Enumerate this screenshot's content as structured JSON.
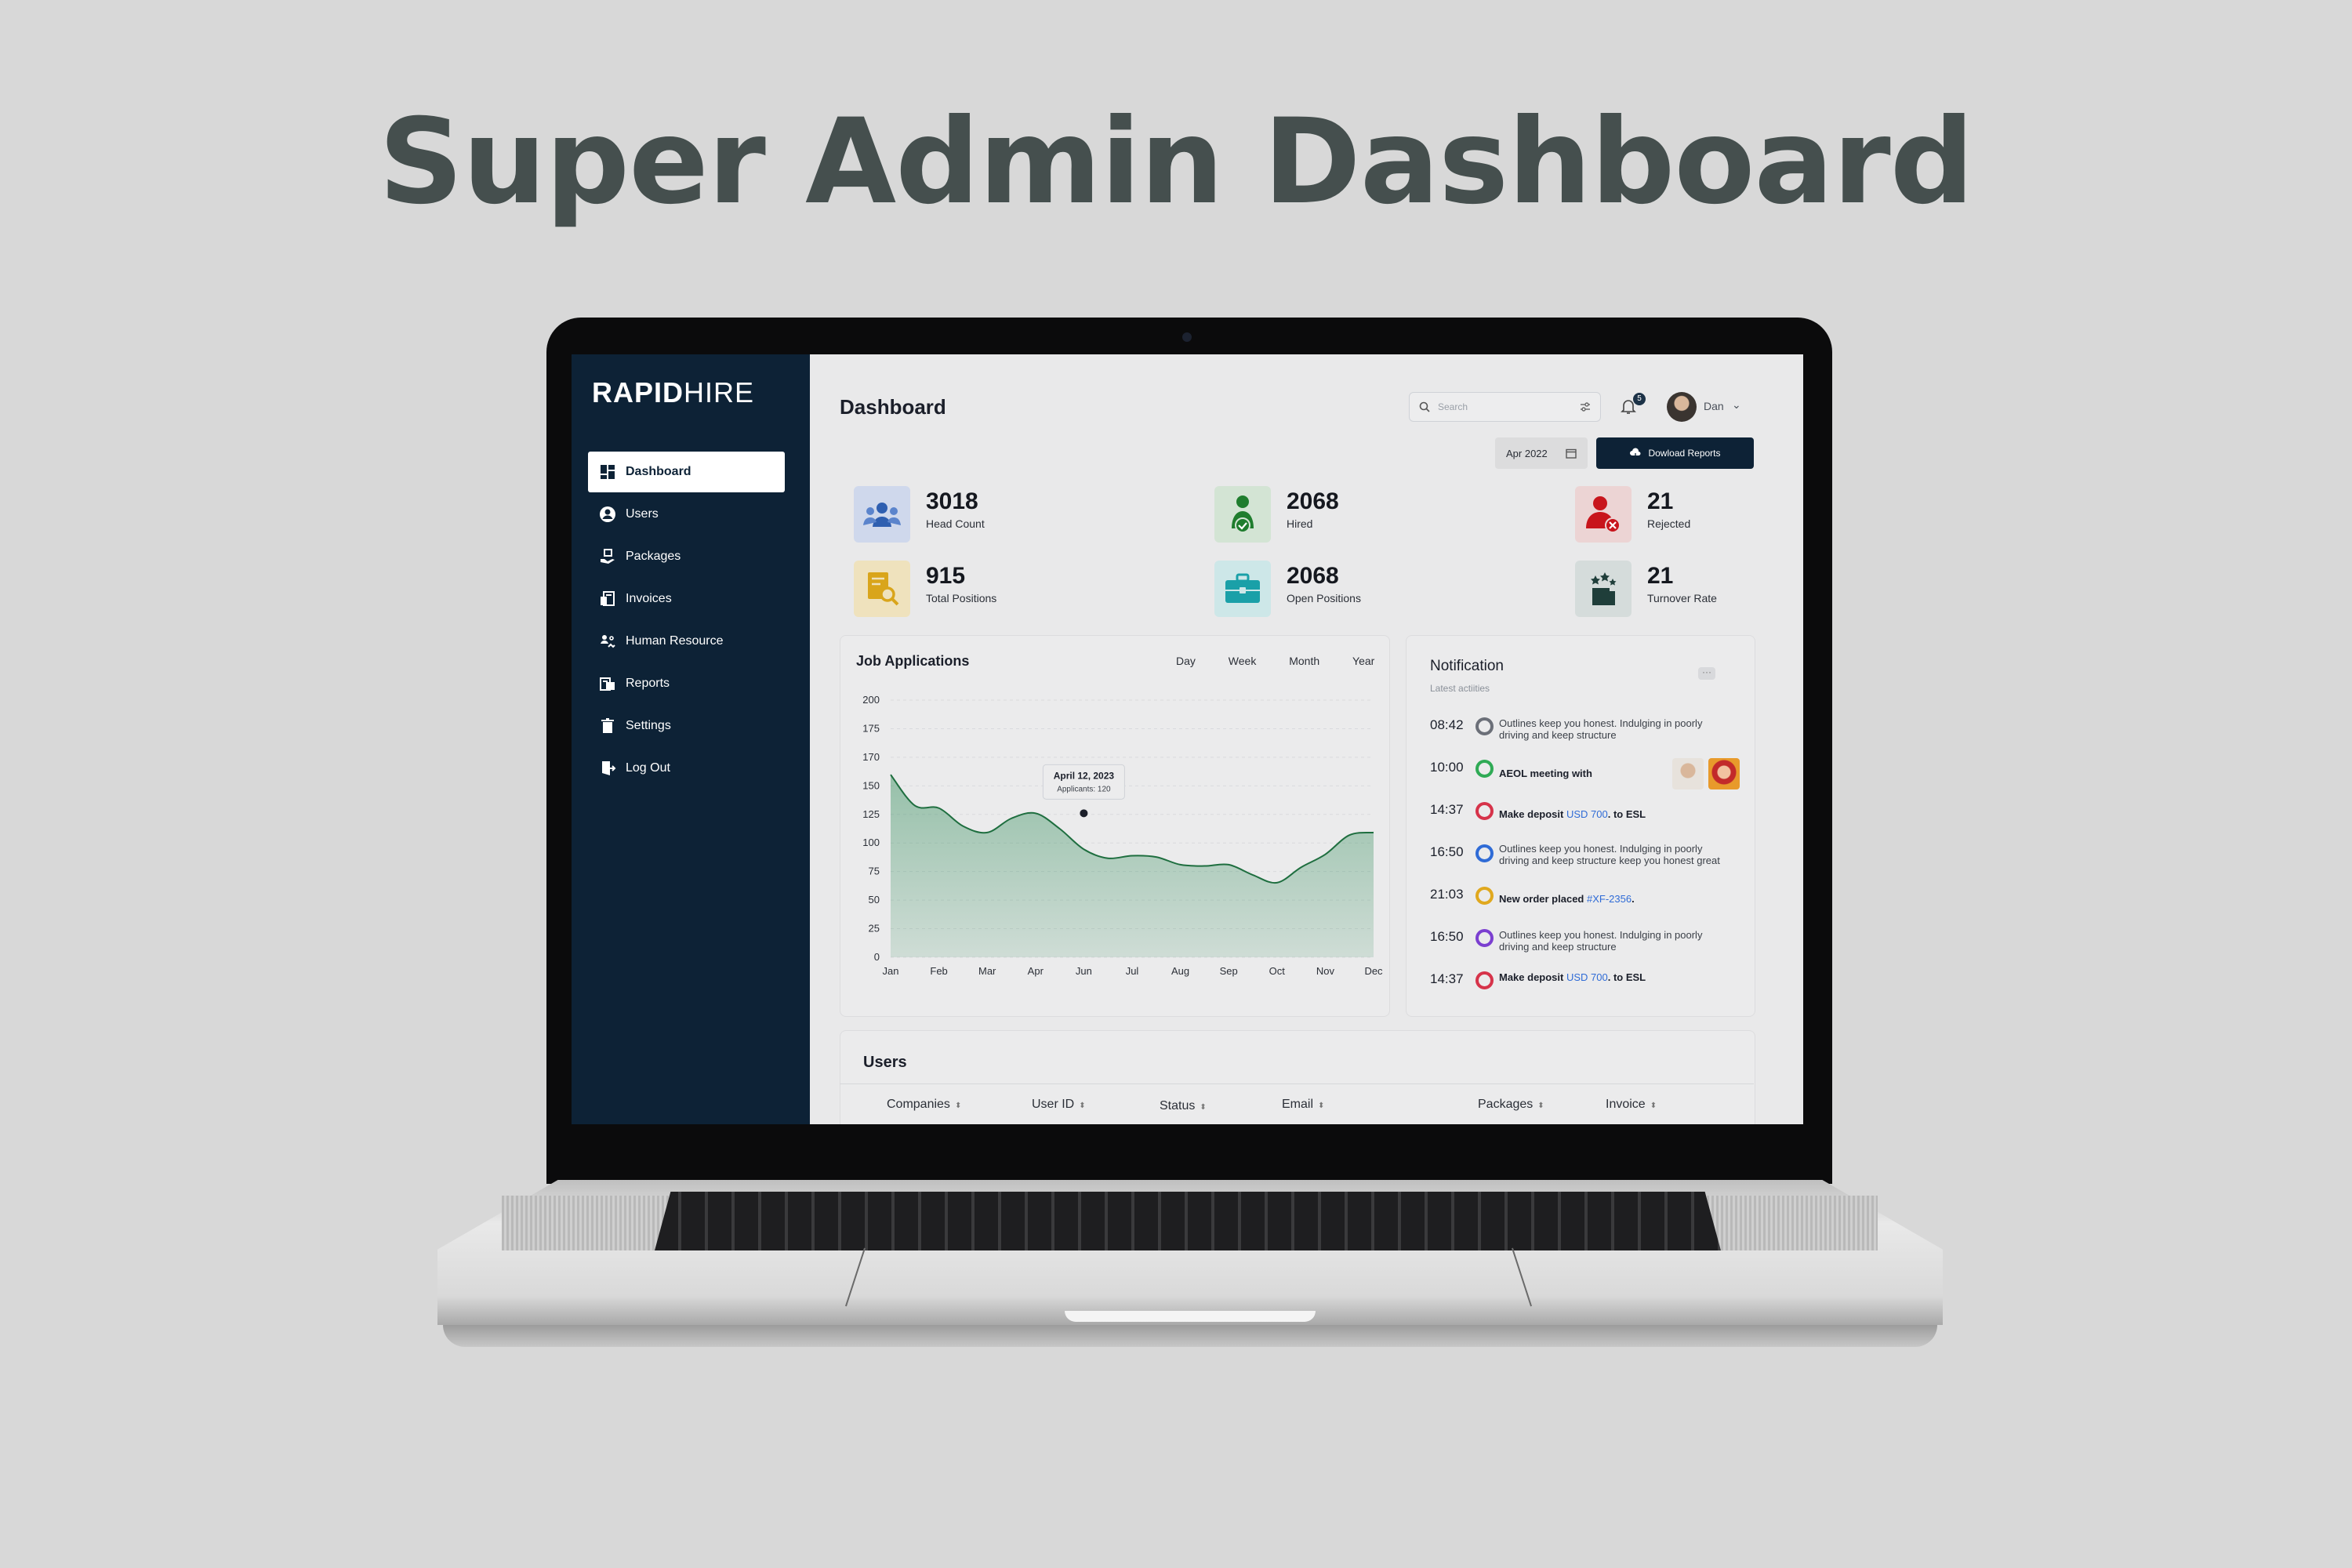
{
  "headline": "Super Admin Dashboard",
  "logo": {
    "bold": "RAPID",
    "light": "HIRE"
  },
  "sidebar": {
    "items": [
      {
        "label": "Dashboard",
        "icon": "dashboard-grid-icon",
        "active": true
      },
      {
        "label": "Users",
        "icon": "user-circle-icon"
      },
      {
        "label": "Packages",
        "icon": "package-hand-icon"
      },
      {
        "label": "Invoices",
        "icon": "invoice-icon"
      },
      {
        "label": "Human Resource",
        "icon": "human-resource-icon"
      },
      {
        "label": "Reports",
        "icon": "reports-icon"
      },
      {
        "label": "Settings",
        "icon": "trash-settings-icon"
      },
      {
        "label": "Log Out",
        "icon": "logout-door-icon"
      }
    ]
  },
  "header": {
    "title": "Dashboard",
    "search_placeholder": "Search",
    "notification_count": "5",
    "user_name": "Dan",
    "date": "Apr 2022",
    "download_label": "Dowload Reports"
  },
  "stats": [
    {
      "value": "3018",
      "label": "Head Count",
      "icon": "team-icon",
      "color": "#2f5fb0"
    },
    {
      "value": "2068",
      "label": "Hired",
      "icon": "user-check-icon",
      "color": "#1f7d2e"
    },
    {
      "value": "21",
      "label": "Rejected",
      "icon": "user-reject-icon",
      "color": "#c8151c"
    },
    {
      "value": "915",
      "label": "Total Positions",
      "icon": "document-search-icon",
      "color": "#d9a51b"
    },
    {
      "value": "2068",
      "label": "Open Positions",
      "icon": "briefcase-icon",
      "color": "#1aa0a8"
    },
    {
      "value": "21",
      "label": "Turnover Rate",
      "icon": "turnover-icon",
      "color": "#1f3e3a"
    }
  ],
  "job_applications": {
    "title": "Job Applications",
    "tabs": [
      "Day",
      "Week",
      "Month",
      "Year"
    ],
    "tooltip": {
      "date": "April 12, 2023",
      "text": "Applicants: 120"
    }
  },
  "chart_data": {
    "type": "area",
    "title": "Job Applications",
    "categories": [
      "Jan",
      "Feb",
      "Mar",
      "Apr",
      "Jun",
      "Jul",
      "Aug",
      "Sep",
      "Oct",
      "Nov",
      "Dec"
    ],
    "y_ticks": [
      "0",
      "25",
      "50",
      "75",
      "100",
      "125",
      "150",
      "170",
      "175",
      "200"
    ],
    "ylim": [
      0,
      200
    ],
    "x": [
      0,
      0.5,
      1,
      1.5,
      2,
      2.5,
      3,
      3.5,
      4,
      4.5,
      5,
      5.5,
      6,
      6.5,
      7,
      7.5,
      8,
      8.5,
      9,
      9.5,
      10
    ],
    "values": [
      142,
      118,
      116,
      102,
      97,
      108,
      112,
      100,
      84,
      77,
      79,
      78,
      72,
      71,
      72,
      64,
      58,
      70,
      80,
      95,
      97
    ],
    "color": "#2e8b57",
    "tooltip_point": {
      "x": 4,
      "y": 112
    }
  },
  "notification": {
    "title": "Notification",
    "subtitle": "Latest actiities",
    "items": [
      {
        "time": "08:42",
        "color": "#6b6f78",
        "text": "Outlines keep you honest. Indulging in poorly driving and keep structure"
      },
      {
        "time": "10:00",
        "color": "#2faa55",
        "text": "AEOL meeting with"
      },
      {
        "time": "14:37",
        "color": "#d6334a",
        "text_a": "Make deposit ",
        "hl": "USD 700",
        "text_b": ". to ESL"
      },
      {
        "time": "16:50",
        "color": "#2f6bd6",
        "text": "Outlines keep you honest. Indulging in poorly driving and keep structure keep you honest great"
      },
      {
        "time": "21:03",
        "color": "#e0a81e",
        "text_a": "New order placed ",
        "hl": "#XF-2356",
        "text_b": "."
      },
      {
        "time": "16:50",
        "color": "#7b3fd0",
        "text": "Outlines keep you honest. Indulging in poorly driving and keep structure"
      },
      {
        "time": "14:37",
        "color": "#d6334a",
        "text_a": "Make deposit ",
        "hl": "USD 700",
        "text_b": ". to ESL"
      }
    ]
  },
  "users_table": {
    "title": "Users",
    "columns": [
      "Companies",
      "User ID",
      "Status",
      "Email",
      "Packages",
      "Invoice"
    ]
  }
}
